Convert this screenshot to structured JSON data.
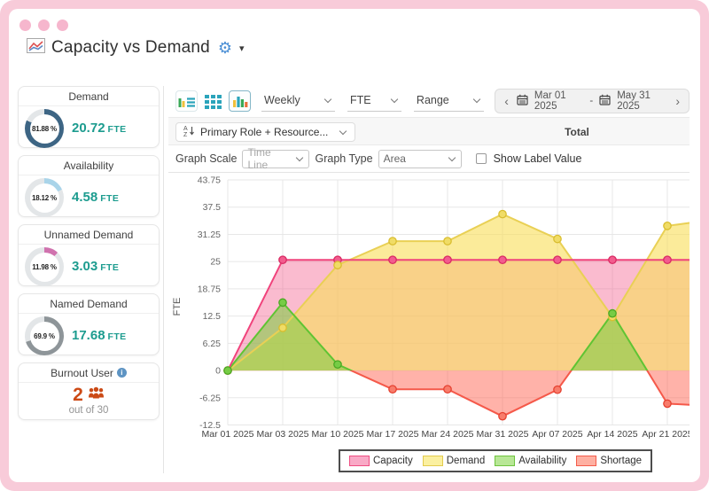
{
  "header": {
    "title": "Capacity vs Demand"
  },
  "sidebar": {
    "cards": [
      {
        "title": "Demand",
        "percent": "81.88 %",
        "value": "20.72",
        "unit": "FTE",
        "pct": 81.88,
        "color": "#3d6584"
      },
      {
        "title": "Availability",
        "percent": "18.12 %",
        "value": "4.58",
        "unit": "FTE",
        "pct": 18.12,
        "color": "#a9d4e9"
      },
      {
        "title": "Unnamed Demand",
        "percent": "11.98 %",
        "value": "3.03",
        "unit": "FTE",
        "pct": 11.98,
        "color": "#d072ae"
      },
      {
        "title": "Named Demand",
        "percent": "69.9 %",
        "value": "17.68",
        "unit": "FTE",
        "pct": 69.9,
        "color": "#8e9599"
      }
    ],
    "burnout": {
      "title": "Burnout User",
      "count": "2",
      "sub": "out of 30"
    }
  },
  "toolbar": {
    "interval": "Weekly",
    "unit": "FTE",
    "mode": "Range",
    "nav_prev": "‹",
    "nav_next": "›",
    "date_start": "Mar 01 2025",
    "date_separator": "-",
    "date_end": "May 31 2025"
  },
  "grouping": {
    "label": "Primary Role + Resource...",
    "column_total": "Total"
  },
  "graph_controls": {
    "scale_label": "Graph Scale",
    "scale_value": "Time Line",
    "type_label": "Graph Type",
    "type_value": "Area",
    "show_label_value": "Show Label Value",
    "show_label_checked": false
  },
  "chart_data": {
    "type": "area",
    "ylabel": "FTE",
    "ylim": [
      -12.5,
      43.75
    ],
    "yticks": [
      43.75,
      37.5,
      31.25,
      25,
      18.75,
      12.5,
      6.25,
      0,
      -6.25,
      -12.5
    ],
    "grid": true,
    "categories": [
      "Mar 01 2025",
      "Mar 03 2025",
      "Mar 10 2025",
      "Mar 17 2025",
      "Mar 24 2025",
      "Mar 31 2025",
      "Apr 07 2025",
      "Apr 14 2025",
      "Apr 21 2025"
    ],
    "series": [
      {
        "name": "Capacity",
        "values": [
          0,
          25.4,
          25.4,
          25.4,
          25.4,
          25.4,
          25.4,
          25.4,
          25.4
        ],
        "edge": 25.4,
        "line": "#f0437c",
        "fill": "rgba(243,93,140,0.42)",
        "dot": "#f25c8e",
        "dot_stroke": "#d92a63"
      },
      {
        "name": "Demand",
        "values": [
          0,
          9.8,
          24.2,
          29.7,
          29.7,
          35.9,
          30.2,
          12.3,
          33.2
        ],
        "edge": 34.2,
        "line": "#e9d055",
        "fill": "rgba(248,222,92,0.62)",
        "dot": "#f0dc66",
        "dot_stroke": "#d9bd2f"
      },
      {
        "name": "Availability/Shortage",
        "values": [
          0,
          15.6,
          1.4,
          -4.3,
          -4.3,
          -10.5,
          -4.4,
          13.1,
          -7.6
        ],
        "edge": -8,
        "line_pos": "#5fc433",
        "line_neg": "#f5594a",
        "fill_pos": "rgba(132,204,70,0.6)",
        "fill_neg": "rgba(255,108,90,0.52)",
        "dot_pos": "#76cc45",
        "dot_neg": "#f87c6b",
        "dot_stroke_pos": "#4aa823",
        "dot_stroke_neg": "#e5402f"
      }
    ],
    "legend_position": "bottom",
    "legend": [
      {
        "label": "Capacity",
        "fill": "#f9a9c6",
        "border": "#ef4d82"
      },
      {
        "label": "Demand",
        "fill": "#fbf0a0",
        "border": "#e3cb4e"
      },
      {
        "label": "Availability",
        "fill": "#b8e796",
        "border": "#6fc43f"
      },
      {
        "label": "Shortage",
        "fill": "#feb0a2",
        "border": "#f45c4b"
      }
    ]
  }
}
